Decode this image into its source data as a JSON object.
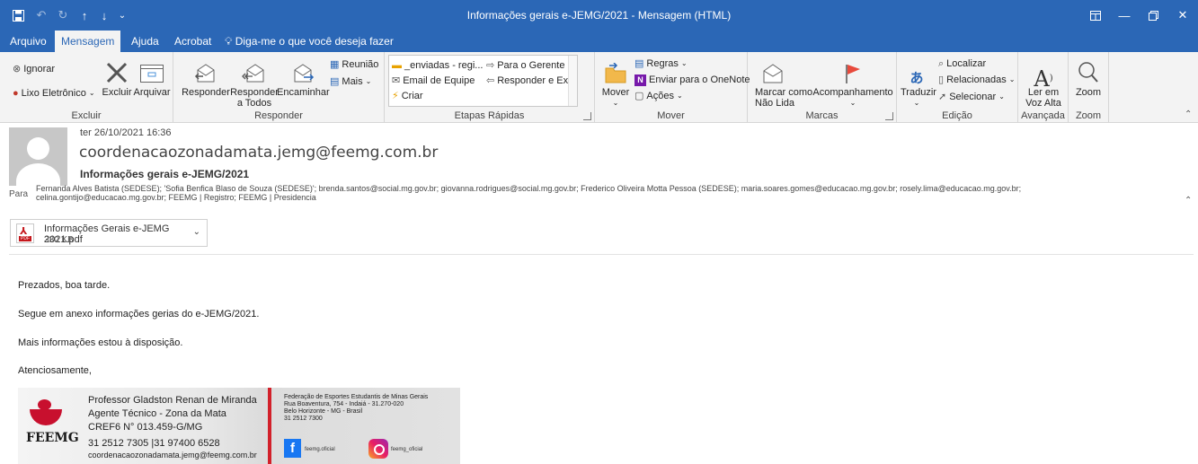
{
  "window": {
    "title": "Informações gerais e-JEMG/2021  -  Mensagem (HTML)"
  },
  "tabs": [
    "Arquivo",
    "Mensagem",
    "Ajuda",
    "Acrobat"
  ],
  "tell_me": "Diga-me o que você deseja fazer",
  "ribbon": {
    "excluir": {
      "ignorar": "Ignorar",
      "lixo": "Lixo Eletrônico",
      "excluir": "Excluir",
      "arquivar": "Arquivar",
      "label": "Excluir"
    },
    "responder": {
      "responder": "Responder",
      "responder_todos_1": "Responder",
      "responder_todos_2": "a Todos",
      "encaminhar": "Encaminhar",
      "reuniao": "Reunião",
      "mais": "Mais",
      "label": "Responder"
    },
    "etapas": {
      "items": [
        "_enviadas - regi...",
        "Para o Gerente",
        "Email de Equipe",
        "Responder e Ex...",
        "Criar"
      ],
      "label": "Etapas Rápidas"
    },
    "mover": {
      "mover": "Mover",
      "regras": "Regras",
      "onenote": "Enviar para o OneNote",
      "acoes": "Ações",
      "label": "Mover"
    },
    "marcas": {
      "marcar_1": "Marcar como",
      "marcar_2": "Não Lida",
      "acompanhamento": "Acompanhamento",
      "label": "Marcas"
    },
    "edicao": {
      "traduzir": "Traduzir",
      "localizar": "Localizar",
      "relacionadas": "Relacionadas",
      "selecionar": "Selecionar",
      "label": "Edição"
    },
    "avancada": {
      "ler_1": "Ler em",
      "ler_2": "Voz Alta",
      "label": "Avançada"
    },
    "zoom": {
      "zoom": "Zoom",
      "label": "Zoom"
    }
  },
  "message": {
    "date": "ter 26/10/2021 16:36",
    "sender": "coordenacaozonadamata.jemg@feemg.com.br",
    "subject": "Informações gerais e-JEMG/2021",
    "to_label": "Para",
    "to_line1": "Fernanda Alves Batista (SEDESE); 'Sofia Benfica Blaso de Souza (SEDESE)'; brenda.santos@social.mg.gov.br; giovanna.rodrigues@social.mg.gov.br; Frederico Oliveira Motta Pessoa (SEDESE); maria.soares.gomes@educacao.mg.gov.br; rosely.lima@educacao.mg.gov.br;",
    "to_line2": "celina.gontijo@educacao.mg.gov.br; FEEMG | Registro; FEEMG | Presidencia",
    "attachment": {
      "name": "Informações Gerais e-JEMG 2021.pdf",
      "size": "330 KB"
    },
    "body": [
      "Prezados, boa tarde.",
      "Segue em anexo informações gerias do e-JEMG/2021.",
      "Mais informações estou à disposição.",
      "Atenciosamente,"
    ]
  },
  "signature": {
    "logo_text": "FEEMG",
    "name": "Professor Gladston Renan de Miranda",
    "role": "Agente Técnico - Zona da Mata",
    "cref": "CREF6 N° 013.459-G/MG",
    "phones": "31 2512 7305 |31 97400 6528",
    "email": "coordenacaozonadamata.jemg@feemg.com.br",
    "fed_1": "Federação de Esportes Estudantis de Minas Gerais",
    "fed_2": "Rua Boaventura, 754 - Indaiá - 31.270-020",
    "fed_3": "Belo Horizonte - MG - Brasil",
    "fed_4": "31 2512 7300",
    "facebook": "feemg.oficial",
    "instagram": "feemg_oficial"
  },
  "colors": {
    "accent": "#2b67b6",
    "brand_red": "#c8102e"
  }
}
